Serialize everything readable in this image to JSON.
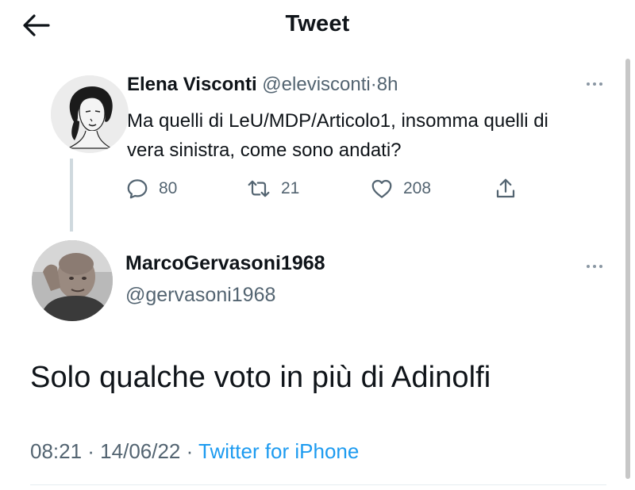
{
  "header": {
    "title": "Tweet",
    "back_icon": "arrow-left-icon"
  },
  "parent_tweet": {
    "display_name": "Elena Visconti",
    "handle": "@elevisconti",
    "separator": "·",
    "time": "8h",
    "text": "Ma quelli di LeU/MDP/Articolo1, insomma quelli di vera sinistra, come sono andati?",
    "replies": "80",
    "retweets": "21",
    "likes": "208",
    "icons": [
      "reply-icon",
      "retweet-icon",
      "like-icon",
      "share-icon",
      "more-icon"
    ]
  },
  "main_tweet": {
    "display_name": "MarcoGervasoni1968",
    "handle": "@gervasoni1968",
    "text": "Solo qualche voto in più di Adinolfi",
    "timestamp": "08:21 · 14/06/22 ·",
    "source": "Twitter for iPhone"
  },
  "colors": {
    "text_primary": "#0f1419",
    "text_secondary": "#536471",
    "link": "#1d9bf0",
    "thread_line": "#cfd9de"
  }
}
